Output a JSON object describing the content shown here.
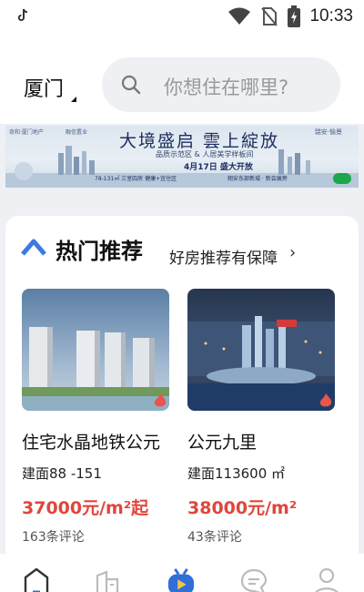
{
  "status_bar": {
    "app_icon": "tiktok-icon",
    "time": "10:33",
    "icons": [
      "wifi-icon",
      "no-sim-icon",
      "battery-charging-icon"
    ]
  },
  "header": {
    "city": "厦门",
    "search_placeholder": "你想住在哪里?"
  },
  "banner": {
    "logo_left": "奇和·厦门地产",
    "logo_right": "融信置业",
    "title": "大境盛启  雲上綻放",
    "brand": "瑞安·愉景",
    "subtitle": "品质示范区 & 人居美学样板间",
    "date": "4月17日 盛大开放",
    "foot_left": "78-131㎡ 三室四房 健康+宜住区",
    "foot_right": "翔安东部新城 · 新会展旁"
  },
  "recommend": {
    "title": "热门推荐",
    "subtitle": "好房推荐有保障",
    "more": "›",
    "items": [
      {
        "name": "住宅水晶地铁公元",
        "area": "建面88 -151",
        "price": "37000元/m²起",
        "comments": "163条评论"
      },
      {
        "name": "公元九里",
        "area": "建面113600 ㎡",
        "price": "38000元/m²",
        "comments": "43条评论"
      }
    ]
  },
  "tabbar": {
    "items": [
      "home-icon",
      "building-icon",
      "video-icon",
      "message-icon",
      "user-icon"
    ],
    "accent": "#2f6fd6"
  }
}
